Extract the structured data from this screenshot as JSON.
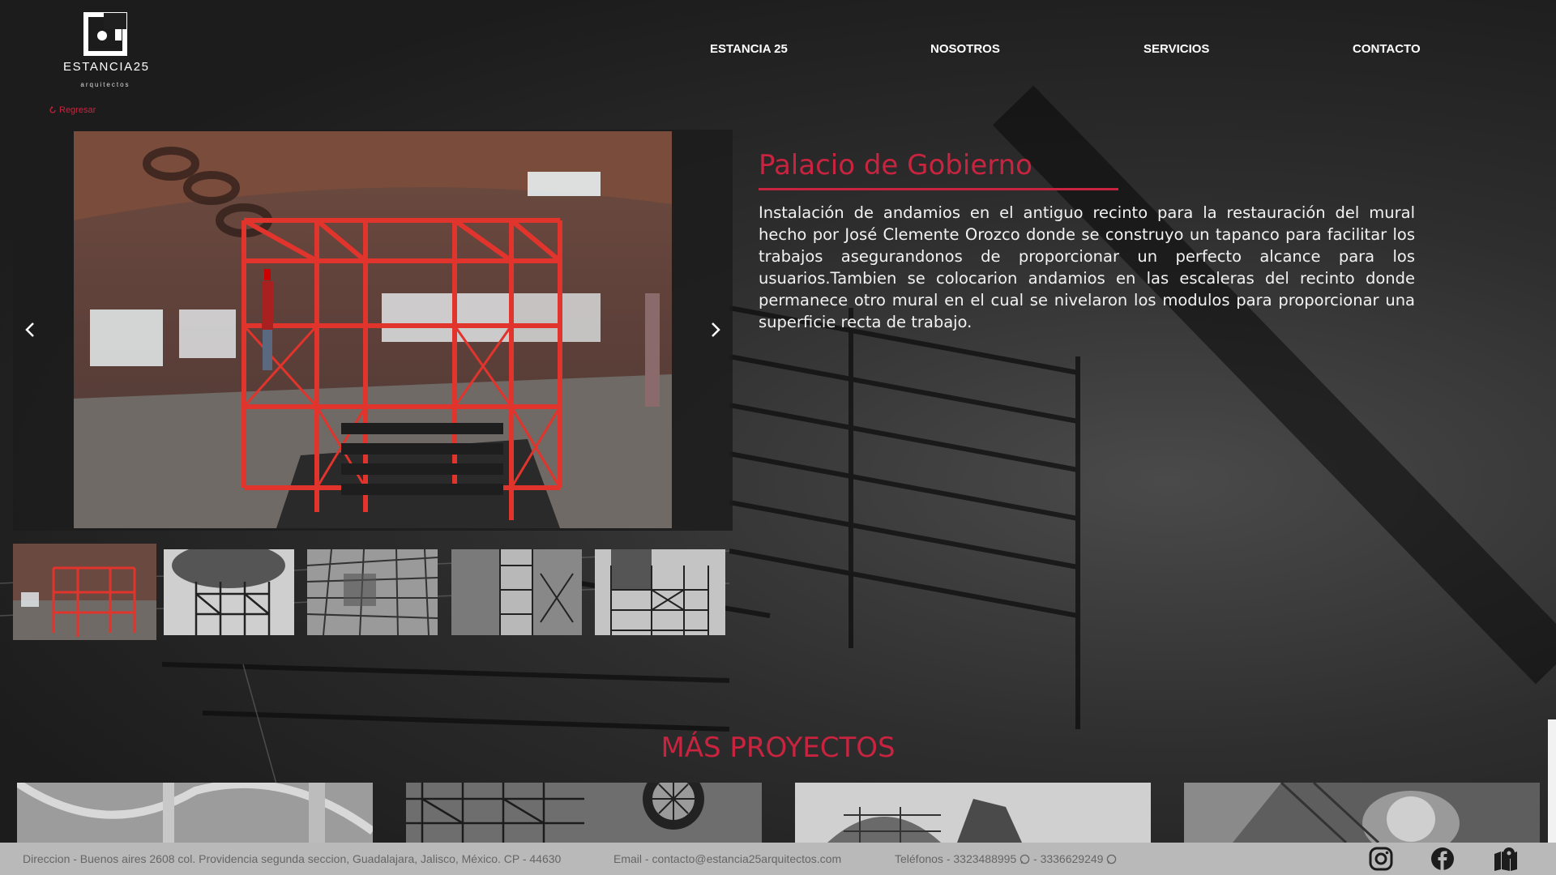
{
  "header": {
    "logo": {
      "brand": "ESTANCIA25",
      "sub": "arquitectos"
    },
    "nav": [
      {
        "label": "ESTANCIA 25"
      },
      {
        "label": "NOSOTROS"
      },
      {
        "label": "SERVICIOS"
      },
      {
        "label": "CONTACTO"
      }
    ]
  },
  "back_link": {
    "label": "Regresar",
    "icon": "back-arrow-icon"
  },
  "project": {
    "title": "Palacio de Gobierno",
    "description": "Instalación de andamios en el antiguo recinto para la restauración del mural hecho por José Clemente Orozco donde se construyo un tapanco para facilitar los trabajos asegurandonos de proporcionar un perfecto alcance para los usuarios.Tambien se colocarion andamios en las escaleras del recinto donde permanece otro mural en el cual se nivelaron los modulos para proporcionar una superficie recta de trabajo."
  },
  "gallery": {
    "thumbnail_count": 5,
    "active_index": 0,
    "prev_icon": "chevron-left-icon",
    "next_icon": "chevron-right-icon"
  },
  "more_projects": {
    "title": "MÁS PROYECTOS"
  },
  "footer": {
    "address": "Direccion - Buenos aires 2608 col. Providencia segunda seccion, Guadalajara, Jalisco, México. CP - 44630",
    "email": "Email - contacto@estancia25arquitectos.com",
    "phones": "Teléfonos - 3323488995",
    "phone2": "- 3336629249",
    "social": [
      "instagram-icon",
      "facebook-icon",
      "map-icon"
    ]
  },
  "colors": {
    "accent": "#c9243f",
    "footer_bg": "#b9b9b9",
    "background": "#1f1f1f"
  }
}
